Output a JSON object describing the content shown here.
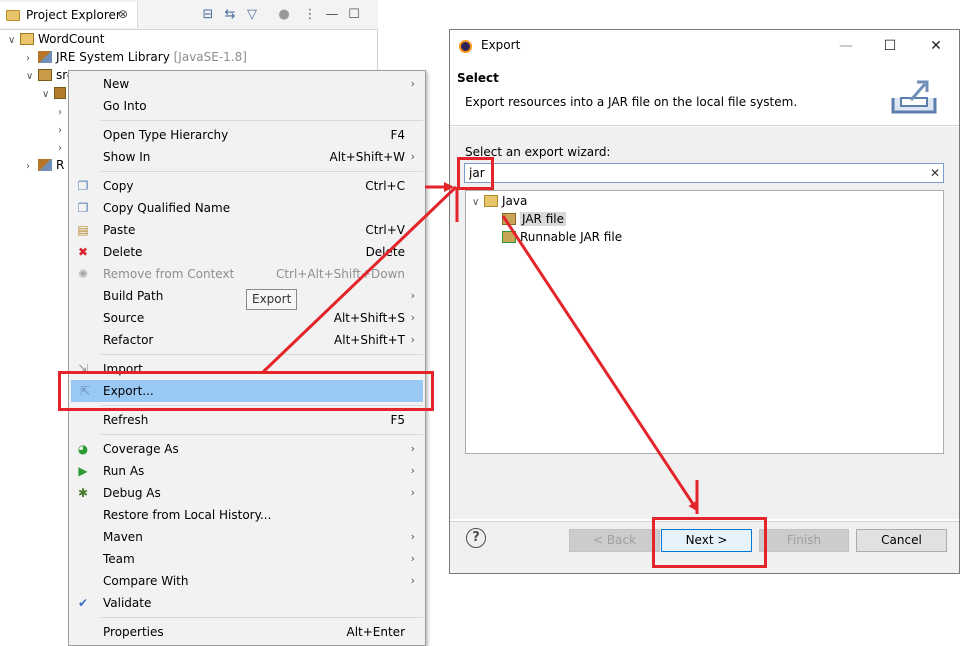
{
  "project_explorer": {
    "title": "Project Explorer",
    "close_glyph": "⊗",
    "toolbar_icons": [
      "collapse-all-icon",
      "link-editor-icon",
      "filter-icon",
      "focus-icon",
      "view-menu-icon",
      "minimize-icon",
      "maximize-icon"
    ],
    "tree": {
      "project": "WordCount",
      "library": "JRE System Library",
      "library_version": "[JavaSE-1.8]",
      "src_folder": "src",
      "second_item": "R"
    }
  },
  "context_menu": {
    "items": [
      {
        "label": "New",
        "submenu": true
      },
      {
        "label": "Go Into"
      },
      {
        "label": "Open Type Hierarchy",
        "accel": "F4"
      },
      {
        "label": "Show In",
        "accel": "Alt+Shift+W",
        "submenu": true
      },
      {
        "label": "Copy",
        "accel": "Ctrl+C"
      },
      {
        "label": "Copy Qualified Name"
      },
      {
        "label": "Paste",
        "accel": "Ctrl+V"
      },
      {
        "label": "Delete",
        "accel": "Delete"
      },
      {
        "label": "Remove from Context",
        "accel": "Ctrl+Alt+Shift+Down",
        "disabled": true
      },
      {
        "label": "Build Path",
        "submenu": true
      },
      {
        "label": "Source",
        "accel": "Alt+Shift+S",
        "submenu": true
      },
      {
        "label": "Refactor",
        "accel": "Alt+Shift+T",
        "submenu": true
      },
      {
        "label": "Import..."
      },
      {
        "label": "Export...",
        "selected": true
      },
      {
        "label": "Refresh",
        "accel": "F5"
      },
      {
        "label": "Coverage As",
        "submenu": true
      },
      {
        "label": "Run As",
        "submenu": true
      },
      {
        "label": "Debug As",
        "submenu": true
      },
      {
        "label": "Restore from Local History..."
      },
      {
        "label": "Maven",
        "submenu": true
      },
      {
        "label": "Team",
        "submenu": true
      },
      {
        "label": "Compare With",
        "submenu": true
      },
      {
        "label": "Validate"
      },
      {
        "label": "Properties",
        "accel": "Alt+Enter"
      }
    ],
    "submenu_glyph": "›",
    "tooltip": "Export"
  },
  "export_dialog": {
    "title": "Export",
    "window_buttons": {
      "minimize": "—",
      "maximize": "☐",
      "close": "✕"
    },
    "banner_title": "Select",
    "banner_description": "Export resources into a JAR file on the local file system.",
    "wizard_label": "Select an export wizard:",
    "filter_value": "jar",
    "clear_glyph": "✕",
    "tree": {
      "category": "Java",
      "items": [
        "JAR file",
        "Runnable JAR file"
      ]
    },
    "buttons": {
      "help": "?",
      "back": "< Back",
      "next": "Next >",
      "finish": "Finish",
      "cancel": "Cancel"
    }
  },
  "colors": {
    "highlight_red": "#e3242b",
    "menu_selection": "#99c8f5"
  }
}
